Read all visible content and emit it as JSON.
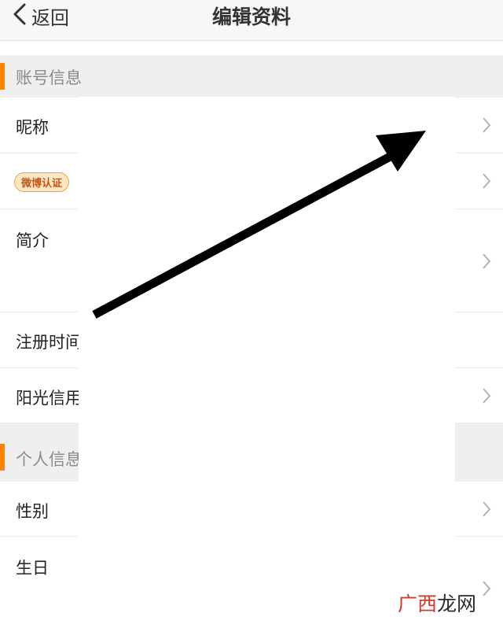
{
  "navbar": {
    "back_label": "返回",
    "title": "编辑资料"
  },
  "sections": {
    "account": {
      "label": "账号信息"
    },
    "personal": {
      "label": "个人信息"
    }
  },
  "rows": {
    "nickname": {
      "label": "昵称"
    },
    "weibo_verify": {
      "badge": "微博认证"
    },
    "bio": {
      "label": "简介"
    },
    "register_time": {
      "label": "注册时间"
    },
    "sunshine_credit": {
      "label": "阳光信用"
    },
    "gender": {
      "label": "性别"
    },
    "birthday": {
      "label": "生日"
    }
  },
  "watermark": {
    "part1": "广西",
    "part2": "龙网"
  },
  "colors": {
    "accent": "#ff8200",
    "section_bg": "#efefef",
    "badge_bg": "#fde7c2",
    "badge_text": "#c8541b"
  },
  "icons": {
    "back": "chevron-left-icon",
    "row_arrow": "chevron-right-icon",
    "annotation": "arrow-annotation"
  }
}
